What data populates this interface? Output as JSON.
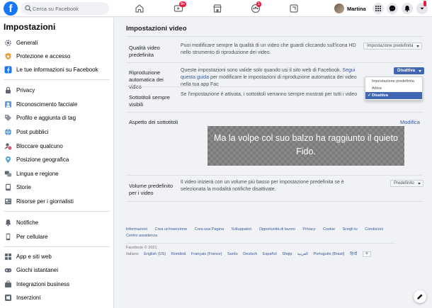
{
  "topbar": {
    "logo": "f",
    "search_placeholder": "Cerca su Facebook",
    "nav": [
      {
        "icon": "home-icon"
      },
      {
        "icon": "watch-icon",
        "badge": "9+"
      },
      {
        "icon": "marketplace-icon"
      },
      {
        "icon": "groups-icon",
        "badge": "1"
      },
      {
        "icon": "gaming-icon"
      }
    ],
    "user_name": "Martina"
  },
  "sidebar": {
    "title": "Impostazioni",
    "items": [
      {
        "label": "Generali",
        "icon": "gear-icon"
      },
      {
        "label": "Protezione e accesso",
        "icon": "shield-icon"
      },
      {
        "label": "Le tue informazioni su Facebook",
        "icon": "facebook-icon"
      },
      {
        "label": "Privacy",
        "icon": "lock-icon"
      },
      {
        "label": "Riconoscimento facciale",
        "icon": "face-icon"
      },
      {
        "label": "Profilo e aggiunta di tag",
        "icon": "tag-icon"
      },
      {
        "label": "Post pubblici",
        "icon": "globe-icon"
      },
      {
        "label": "Bloccare qualcuno",
        "icon": "block-icon"
      },
      {
        "label": "Posizione geografica",
        "icon": "location-icon"
      },
      {
        "label": "Lingua e regione",
        "icon": "language-icon"
      },
      {
        "label": "Storie",
        "icon": "stories-icon"
      },
      {
        "label": "Risorse per i giornalisti",
        "icon": "journalist-icon"
      },
      {
        "label": "Notifiche",
        "icon": "bell-icon"
      },
      {
        "label": "Per cellulare",
        "icon": "phone-icon"
      },
      {
        "label": "App e siti web",
        "icon": "apps-icon"
      },
      {
        "label": "Giochi istantanei",
        "icon": "games-icon"
      },
      {
        "label": "Integrazioni business",
        "icon": "business-icon"
      },
      {
        "label": "Inserzioni",
        "icon": "ads-icon"
      }
    ]
  },
  "video_settings": {
    "title": "Impostazioni video",
    "rows": [
      {
        "label": "Qualità video predefinita",
        "desc": "Puoi modificare sempre la qualità di un video che guardi cliccando sull'icona HD nello strumento di riproduzione dei video.",
        "control": "Impostazione predefinita"
      },
      {
        "label": "Riproduzione automatica dei video",
        "desc_pre": "Queste impostazioni sono valide solo quando usi il sito web di Facebook.",
        "desc_link": "Segui questa guida",
        "desc_post": "per modificare le impostazioni di riproduzione automatica dei video nella tua app Fac",
        "control": "Disattiva"
      },
      {
        "label": "Sottotitoli sempre visibili",
        "desc": "Se l'impostazione è attivata, i sottotitoli verranno sempre mostrati per tutti i video"
      },
      {
        "label": "Aspetto dei sottotitoli",
        "edit_label": "Modifica",
        "preview_text": "Ma la volpe col suo balzo ha raggiunto il quieto Fido."
      },
      {
        "label": "Volume predefinito per i video",
        "desc": "Il video inizierà con un volume più basso per impostazione predefinita se è selezionata la modalità notifiche disattivate.",
        "control": "Predefinito"
      }
    ],
    "autoplay_menu": {
      "options": [
        "Impostazione predefinita",
        "Attiva",
        "Disattiva"
      ],
      "selected": "Disattiva",
      "check": "✓"
    }
  },
  "footer": {
    "links": [
      "Informazioni",
      "Crea un'inserzione",
      "Crea una Pagina",
      "Sviluppatori",
      "Opportunità di lavoro",
      "Privacy",
      "Cookie",
      "Scegli tu",
      "Condizioni",
      "Centro assistenza"
    ],
    "copyright": "Facebook © 2021",
    "current_language": "Italiano",
    "languages": [
      "English (US)",
      "Română",
      "Français (France)",
      "Sardu",
      "Deutsch",
      "Español",
      "Shqip",
      "العربية",
      "Português (Brasil)",
      "हिन्दी"
    ],
    "plus": "+"
  },
  "colors": {
    "brand": "#1877f2",
    "link": "#385898",
    "selected": "#4267b2",
    "badge": "#e41e3f"
  }
}
